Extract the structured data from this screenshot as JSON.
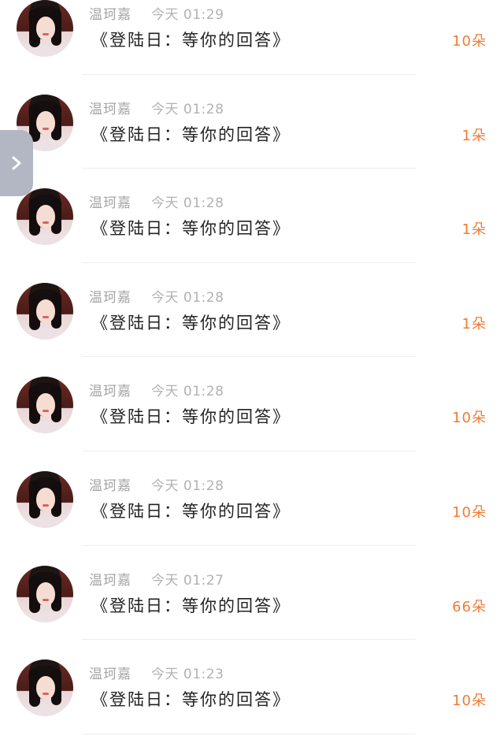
{
  "messages": [
    {
      "name": "温珂嘉",
      "time": "今天 01:29",
      "text": "《登陆日：等你的回答》",
      "count": "10朵"
    },
    {
      "name": "温珂嘉",
      "time": "今天 01:28",
      "text": "《登陆日：等你的回答》",
      "count": "1朵"
    },
    {
      "name": "温珂嘉",
      "time": "今天 01:28",
      "text": "《登陆日：等你的回答》",
      "count": "1朵"
    },
    {
      "name": "温珂嘉",
      "time": "今天 01:28",
      "text": "《登陆日：等你的回答》",
      "count": "1朵"
    },
    {
      "name": "温珂嘉",
      "time": "今天 01:28",
      "text": "《登陆日：等你的回答》",
      "count": "10朵"
    },
    {
      "name": "温珂嘉",
      "time": "今天 01:28",
      "text": "《登陆日：等你的回答》",
      "count": "10朵"
    },
    {
      "name": "温珂嘉",
      "time": "今天 01:27",
      "text": "《登陆日：等你的回答》",
      "count": "66朵"
    },
    {
      "name": "温珂嘉",
      "time": "今天 01:23",
      "text": "《登陆日：等你的回答》",
      "count": "10朵"
    }
  ],
  "side_tab": {
    "icon": "chevron-right-icon"
  },
  "colors": {
    "count": "#f07b35",
    "meta": "#a5a5a5",
    "text": "#222222",
    "side_tab": "#b3b6c3"
  }
}
